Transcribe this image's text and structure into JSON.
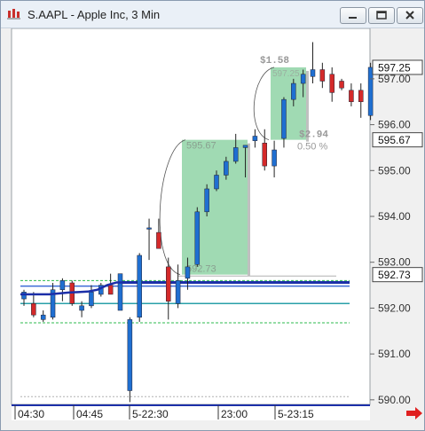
{
  "window": {
    "title": "S.AAPL - Apple Inc, 3 Min",
    "buttons": [
      "minimize",
      "restore",
      "close"
    ]
  },
  "chart_data": {
    "type": "candlestick",
    "ylim": [
      589.9,
      598.1
    ],
    "y_ticks": [
      "590.00",
      "591.00",
      "592.00",
      "593.00",
      "594.00",
      "595.00",
      "596.00",
      "597.00"
    ],
    "x_labels": [
      "04:30",
      "04:45",
      "5-22:30",
      "23:00",
      "5-23:15"
    ],
    "price_markers": [
      {
        "label": "597.25",
        "value": 597.25
      },
      {
        "label": "595.67",
        "value": 595.67
      },
      {
        "label": "592.73",
        "value": 592.73
      }
    ],
    "candles": [
      {
        "o": 592.2,
        "h": 592.4,
        "l": 592.05,
        "c": 592.35
      },
      {
        "o": 592.1,
        "h": 592.35,
        "l": 591.8,
        "c": 591.85
      },
      {
        "o": 591.75,
        "h": 591.95,
        "l": 591.7,
        "c": 591.85
      },
      {
        "o": 591.8,
        "h": 592.55,
        "l": 591.75,
        "c": 592.4
      },
      {
        "o": 592.4,
        "h": 592.65,
        "l": 592.15,
        "c": 592.6
      },
      {
        "o": 592.55,
        "h": 592.6,
        "l": 592.05,
        "c": 592.1
      },
      {
        "o": 591.95,
        "h": 592.15,
        "l": 591.8,
        "c": 592.05
      },
      {
        "o": 592.05,
        "h": 592.5,
        "l": 592.0,
        "c": 592.35
      },
      {
        "o": 592.3,
        "h": 592.55,
        "l": 592.25,
        "c": 592.5
      },
      {
        "o": 592.5,
        "h": 592.75,
        "l": 592.3,
        "c": 592.3
      },
      {
        "o": 591.95,
        "h": 592.75,
        "l": 592.0,
        "c": 592.75
      },
      {
        "o": 590.2,
        "h": 591.8,
        "l": 589.95,
        "c": 591.75
      },
      {
        "o": 591.8,
        "h": 593.2,
        "l": 591.7,
        "c": 593.15
      },
      {
        "o": 593.75,
        "h": 593.95,
        "l": 593.05,
        "c": 593.75
      },
      {
        "o": 593.65,
        "h": 593.95,
        "l": 593.45,
        "c": 593.3
      },
      {
        "o": 592.9,
        "h": 593.1,
        "l": 591.75,
        "c": 592.15
      },
      {
        "o": 592.1,
        "h": 592.95,
        "l": 592.0,
        "c": 592.6
      },
      {
        "o": 592.65,
        "h": 593.1,
        "l": 592.4,
        "c": 592.9
      },
      {
        "o": 592.95,
        "h": 594.2,
        "l": 592.9,
        "c": 594.1
      },
      {
        "o": 594.1,
        "h": 594.7,
        "l": 594.0,
        "c": 594.6
      },
      {
        "o": 594.6,
        "h": 595.0,
        "l": 594.55,
        "c": 594.9
      },
      {
        "o": 594.9,
        "h": 595.3,
        "l": 594.8,
        "c": 595.2
      },
      {
        "o": 595.2,
        "h": 595.8,
        "l": 595.15,
        "c": 595.5
      },
      {
        "o": 595.5,
        "h": 595.55,
        "l": 594.85,
        "c": 595.55
      },
      {
        "o": 595.65,
        "h": 595.9,
        "l": 595.5,
        "c": 595.75
      },
      {
        "o": 595.6,
        "h": 595.9,
        "l": 595.0,
        "c": 595.1
      },
      {
        "o": 595.1,
        "h": 595.65,
        "l": 594.85,
        "c": 595.45
      },
      {
        "o": 595.7,
        "h": 596.6,
        "l": 595.5,
        "c": 596.55
      },
      {
        "o": 596.55,
        "h": 597.0,
        "l": 596.4,
        "c": 596.9
      },
      {
        "o": 596.9,
        "h": 597.2,
        "l": 596.6,
        "c": 597.1
      },
      {
        "o": 597.05,
        "h": 597.8,
        "l": 596.9,
        "c": 597.2
      },
      {
        "o": 597.2,
        "h": 597.35,
        "l": 596.8,
        "c": 596.95
      },
      {
        "o": 597.1,
        "h": 597.25,
        "l": 596.5,
        "c": 596.7
      },
      {
        "o": 596.95,
        "h": 597.0,
        "l": 596.75,
        "c": 596.8
      },
      {
        "o": 596.75,
        "h": 596.9,
        "l": 596.4,
        "c": 596.5
      },
      {
        "o": 596.75,
        "h": 596.9,
        "l": 596.15,
        "c": 596.5
      },
      {
        "o": 596.2,
        "h": 597.35,
        "l": 596.1,
        "c": 597.25
      }
    ],
    "levels": [
      {
        "name": "thick-blue",
        "value": 592.56,
        "color": "#1c2fa8"
      },
      {
        "name": "thin-blue",
        "value": 592.48,
        "color": "#3b6bd6"
      },
      {
        "name": "teal",
        "value": 592.1,
        "color": "#29a0a8"
      },
      {
        "name": "green-upper",
        "value": 592.6,
        "color": "#2dbb4e"
      },
      {
        "name": "green-lower",
        "value": 591.68,
        "color": "#2dbb4e"
      },
      {
        "name": "grey-upper",
        "value": 592.7,
        "color": "#b0b0b0"
      },
      {
        "name": "grey-bottom",
        "value": 590.07,
        "color": "#b0b0b0"
      }
    ],
    "moving_average": [
      592.3,
      592.3,
      592.3,
      592.3,
      592.32,
      592.34,
      592.35,
      592.36,
      592.4,
      592.5,
      592.56,
      592.56
    ],
    "measure_boxes": [
      {
        "from_price": 592.73,
        "to_price": 595.67,
        "top_label": "595.67",
        "bottom_label": "592.73"
      },
      {
        "from_price": 595.67,
        "to_price": 597.25,
        "change_label": "$1.58",
        "pct_label": "597.25",
        "delta_label": "$2.94",
        "pct2_label": "0.50 %"
      }
    ]
  },
  "colors": {
    "up": "#1f6fd1",
    "down": "#d42a2a",
    "box_fill": "#8fd3a6",
    "arrow": "#e02020"
  }
}
